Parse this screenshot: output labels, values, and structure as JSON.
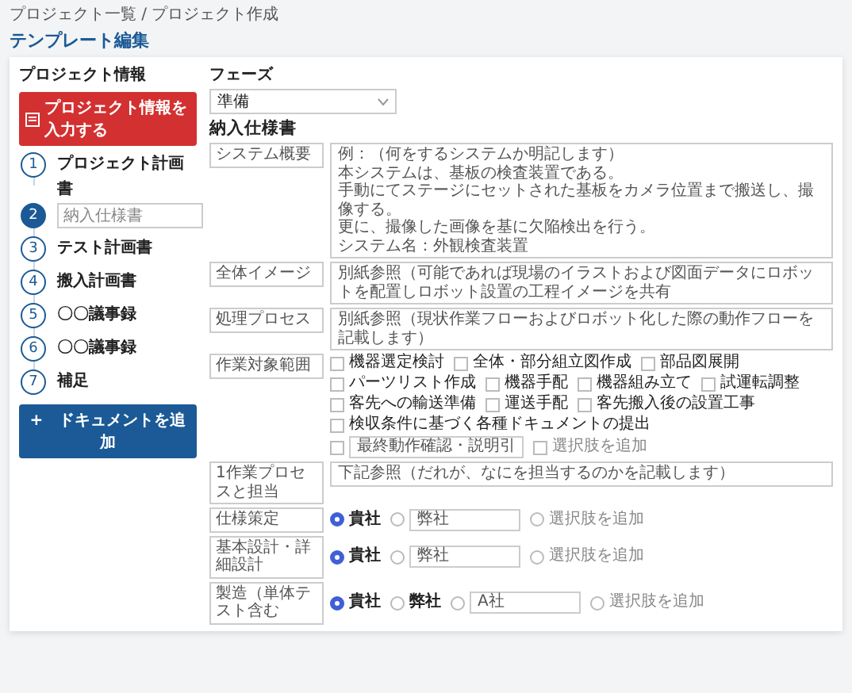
{
  "breadcrumb": "プロジェクト一覧 / プロジェクト作成",
  "page_title": "テンプレート編集",
  "sidebar": {
    "heading": "プロジェクト情報",
    "primary_button": "プロジェクト情報を入力する",
    "steps": [
      {
        "number": "1",
        "kind": "text",
        "label": "プロジェクト計画書",
        "selected": false
      },
      {
        "number": "2",
        "kind": "input",
        "placeholder": "納入仕様書",
        "selected": true
      },
      {
        "number": "3",
        "kind": "text",
        "label": "テスト計画書",
        "selected": false
      },
      {
        "number": "4",
        "kind": "text",
        "label": "搬入計画書",
        "selected": false
      },
      {
        "number": "5",
        "kind": "text",
        "label": "〇〇議事録",
        "selected": false
      },
      {
        "number": "6",
        "kind": "text",
        "label": "〇〇議事録",
        "selected": false
      },
      {
        "number": "7",
        "kind": "text",
        "label": "補足",
        "selected": false
      }
    ],
    "add_button_icon": "+",
    "add_button": "ドキュメントを追加"
  },
  "phase": {
    "label": "フェーズ",
    "value": "準備"
  },
  "section_title": "納入仕様書",
  "fields": [
    {
      "kind": "textarea",
      "label": "システム概要",
      "lines": [
        "例：（何をするシステムか明記します）",
        "本システムは、基板の検査装置である。",
        "手動にてステージにセットされた基板をカメラ位置まで搬送し、撮像する。",
        "更に、撮像した画像を基に欠陥検出を行う。",
        "システム名：外観検査装置"
      ]
    },
    {
      "kind": "text",
      "label": "全体イメージ",
      "value": "別紙参照（可能であれば現場のイラストおよび図面データにロボットを配置しロボット設置の工程イメージを共有"
    },
    {
      "kind": "text",
      "label": "処理プロセス",
      "value": "別紙参照（現状作業フローおよびロボット化した際の動作フローを記載します）"
    },
    {
      "kind": "checks",
      "label": "作業対象範囲",
      "options": [
        {
          "kind": "option",
          "label": "機器選定検討",
          "checked": false
        },
        {
          "kind": "option",
          "label": "全体・部分組立図作成",
          "checked": false
        },
        {
          "kind": "option",
          "label": "部品図展開",
          "checked": false
        },
        {
          "kind": "option",
          "label": "パーツリスト作成",
          "checked": false
        },
        {
          "kind": "option",
          "label": "機器手配",
          "checked": false
        },
        {
          "kind": "option",
          "label": "機器組み立て",
          "checked": false
        },
        {
          "kind": "option",
          "label": "試運転調整",
          "checked": false
        },
        {
          "kind": "option",
          "label": "客先への輸送準備",
          "checked": false
        },
        {
          "kind": "option",
          "label": "運送手配",
          "checked": false
        },
        {
          "kind": "option",
          "label": "客先搬入後の設置工事",
          "checked": false
        },
        {
          "kind": "option",
          "label": "検収条件に基づく各種ドキュメントの提出",
          "checked": false
        },
        {
          "kind": "input",
          "value": "最終動作確認・説明引",
          "checked": false
        },
        {
          "kind": "add",
          "label": "選択肢を追加",
          "checked": false
        }
      ]
    },
    {
      "kind": "text",
      "label": "1作業プロセスと担当",
      "value": "下記参照（だれが、なにを担当するのかを記載します）"
    },
    {
      "kind": "radios",
      "label": "仕様策定",
      "options": [
        {
          "kind": "option",
          "label": "貴社",
          "selected": true
        },
        {
          "kind": "input",
          "value": "弊社",
          "selected": false
        },
        {
          "kind": "add",
          "label": "選択肢を追加",
          "selected": false
        }
      ]
    },
    {
      "kind": "radios",
      "label": "基本設計・詳細設計",
      "options": [
        {
          "kind": "option",
          "label": "貴社",
          "selected": true
        },
        {
          "kind": "input",
          "value": "弊社",
          "selected": false
        },
        {
          "kind": "add",
          "label": "選択肢を追加",
          "selected": false
        }
      ]
    },
    {
      "kind": "radios",
      "label": "製造（単体テスト含む",
      "options": [
        {
          "kind": "option",
          "label": "貴社",
          "selected": true
        },
        {
          "kind": "option",
          "label": "弊社",
          "selected": false
        },
        {
          "kind": "input",
          "value": "A社",
          "selected": false
        },
        {
          "kind": "add",
          "label": "選択肢を追加",
          "selected": false
        }
      ]
    }
  ]
}
